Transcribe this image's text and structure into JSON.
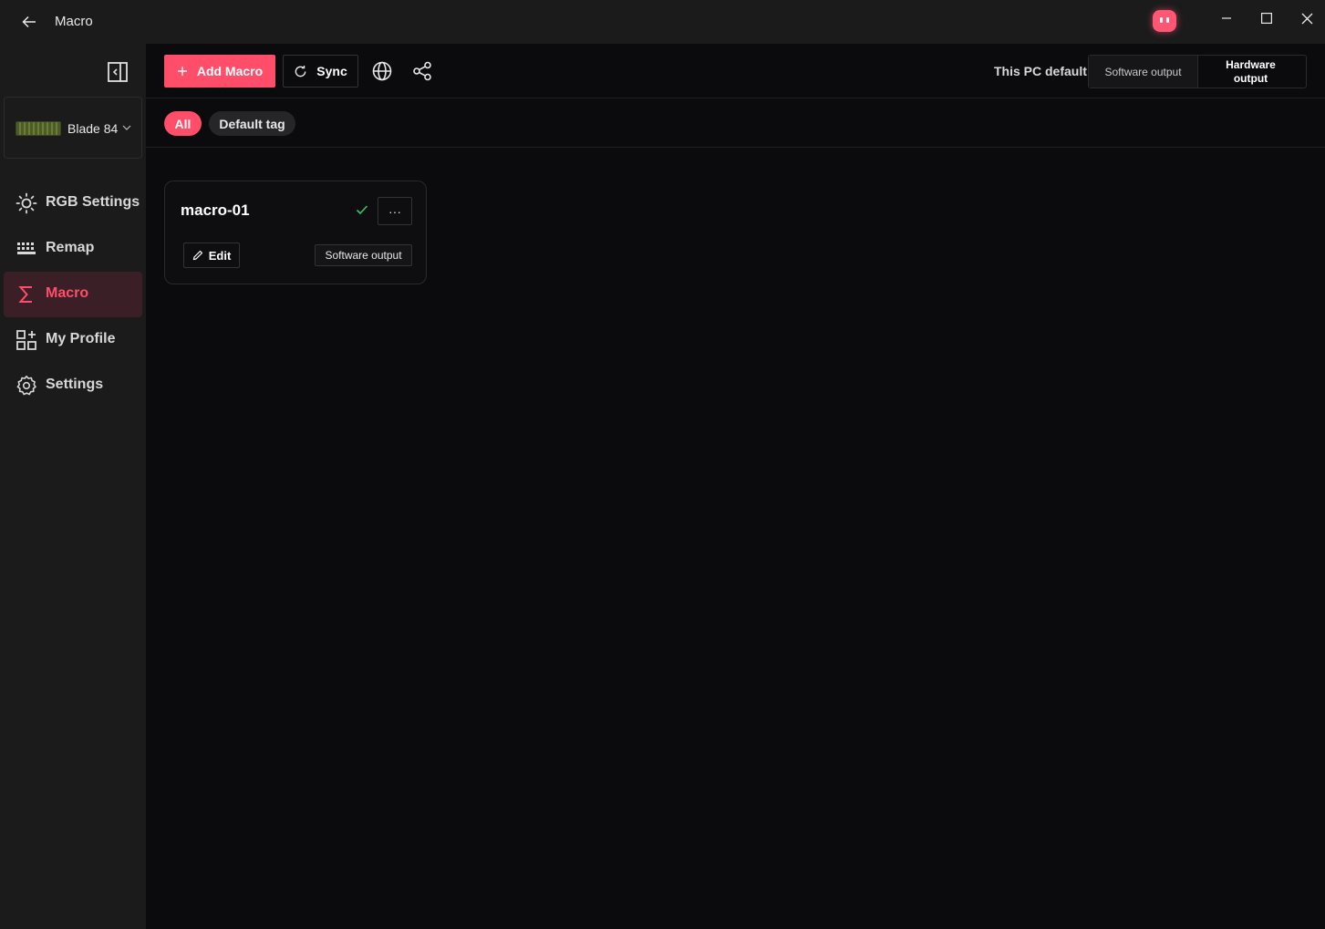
{
  "window": {
    "title": "Macro"
  },
  "sidebar": {
    "device": {
      "name": "Blade 84"
    },
    "items": [
      {
        "label": "RGB Settings",
        "icon": "sun-icon",
        "active": false
      },
      {
        "label": "Remap",
        "icon": "keyboard-icon",
        "active": false
      },
      {
        "label": "Macro",
        "icon": "sigma-icon",
        "active": true
      },
      {
        "label": "My Profile",
        "icon": "grid-plus-icon",
        "active": false
      },
      {
        "label": "Settings",
        "icon": "gear-icon",
        "active": false
      }
    ]
  },
  "toolbar": {
    "add_label": "Add Macro",
    "sync_label": "Sync",
    "pc_default_label": "This PC default",
    "output_options": [
      "Software output",
      "Hardware output"
    ]
  },
  "tags": [
    "All",
    "Default tag"
  ],
  "macros": [
    {
      "name": "macro-01",
      "edit_label": "Edit",
      "output": "Software output",
      "more_label": "···"
    }
  ],
  "colors": {
    "accent": "#ff4d6a",
    "active_nav_bg": "#3a1f26",
    "check": "#3cc36b",
    "sidebar_bg": "#1b1b1c",
    "main_bg": "#0b0b0d"
  }
}
